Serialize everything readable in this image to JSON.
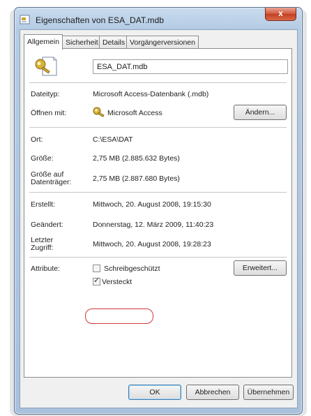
{
  "window": {
    "title": "Eigenschaften von ESA_DAT.mdb",
    "close_label": "x"
  },
  "tabs": [
    {
      "label": "Allgemein",
      "active": true
    },
    {
      "label": "Sicherheit",
      "active": false
    },
    {
      "label": "Details",
      "active": false
    },
    {
      "label": "Vorgängerversionen",
      "active": false
    }
  ],
  "file": {
    "name": "ESA_DAT.mdb",
    "icon": "access-db-file-icon"
  },
  "info": {
    "dateityp": {
      "label": "Dateityp:",
      "value": "Microsoft Access-Datenbank (.mdb)"
    },
    "oeffnen": {
      "label": "Öffnen mit:",
      "value": "Microsoft Access",
      "button": "Ändern...",
      "icon": "access-key-icon"
    },
    "ort": {
      "label": "Ort:",
      "value": "C:\\ESA\\DAT"
    },
    "groesse": {
      "label": "Größe:",
      "value": "2,75 MB (2.885.632 Bytes)"
    },
    "groesse_auf": {
      "label_line1": "Größe auf",
      "label_line2": "Datenträger:",
      "value": "2,75 MB (2.887.680 Bytes)"
    },
    "erstellt": {
      "label": "Erstellt:",
      "value": "Mittwoch, 20. August 2008, 19:15:30"
    },
    "geaendert": {
      "label": "Geändert:",
      "value": "Donnerstag, 12. März 2009, 11:40:23"
    },
    "zugriff": {
      "label_line1": "Letzter",
      "label_line2": "Zugriff:",
      "value": "Mittwoch, 20. August 2008, 19:28:23"
    }
  },
  "attributes": {
    "label": "Attribute:",
    "schreibgeschuetzt": {
      "label": "Schreibgeschützt",
      "checked": false
    },
    "versteckt": {
      "label": "Versteckt",
      "checked": true
    },
    "erweitert_button": "Erweitert..."
  },
  "footer": {
    "ok": "OK",
    "cancel": "Abbrechen",
    "apply": "Übernehmen"
  },
  "colors": {
    "highlight": "#d03a3a",
    "title_bar": "#b5cce4",
    "close_button": "#c33d1f"
  }
}
